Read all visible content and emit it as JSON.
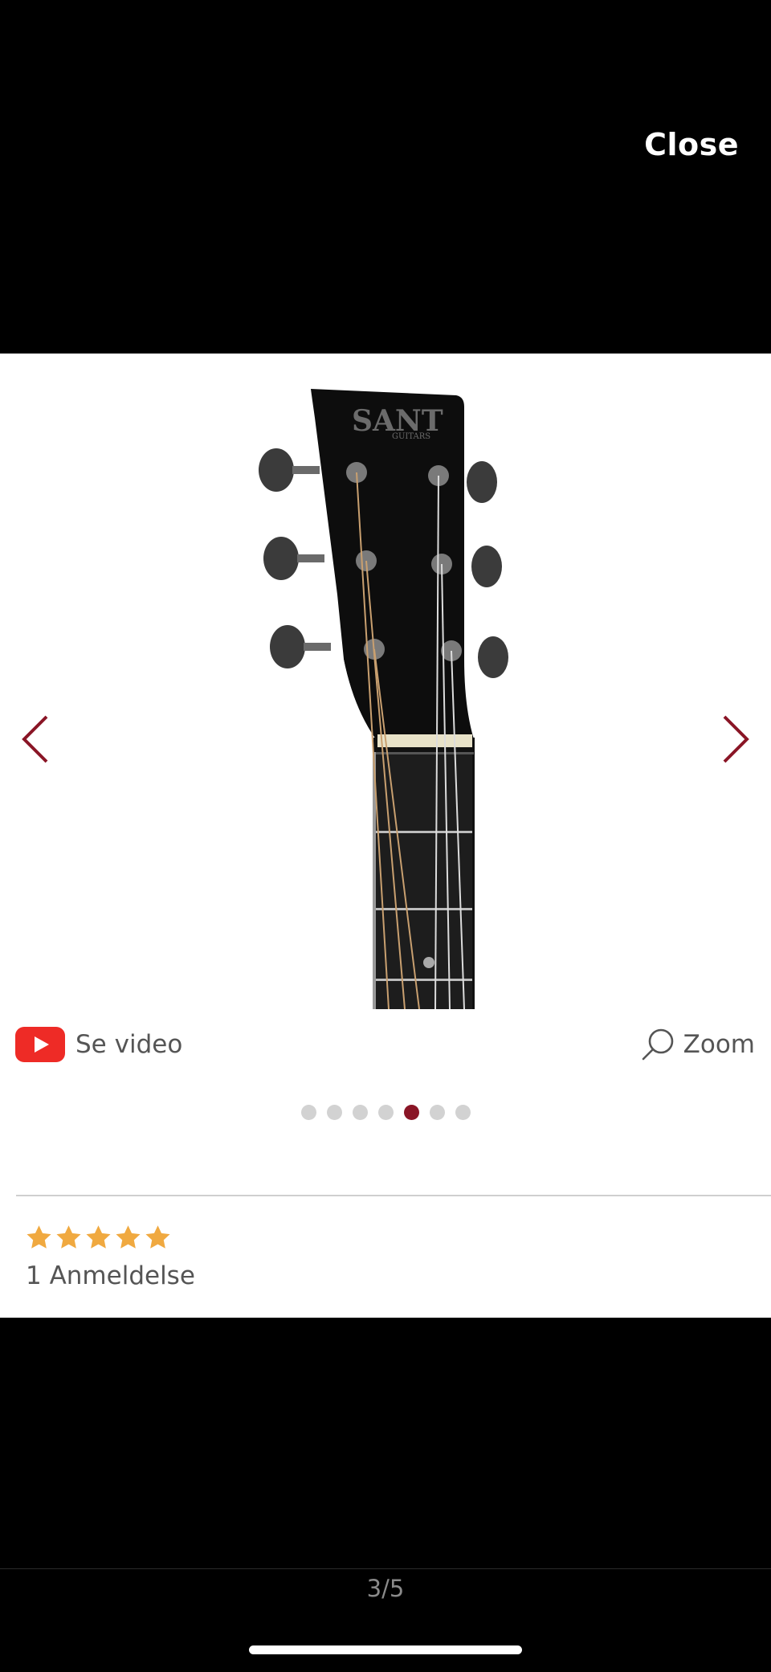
{
  "header": {
    "close_label": "Close"
  },
  "product": {
    "brand_text": "SANT",
    "brand_sub": "GUITARS"
  },
  "gallery": {
    "dots_total": 7,
    "active_dot_index": 4,
    "counter": "3/5"
  },
  "actions": {
    "video_label": "Se video",
    "zoom_label": "Zoom"
  },
  "reviews": {
    "rating": 5,
    "max_rating": 5,
    "count_label": "1 Anmeldelse"
  },
  "colors": {
    "accent": "#8a1526",
    "star": "#f0a940",
    "youtube": "#ee2b26"
  },
  "icons": [
    "chevron-left-icon",
    "chevron-right-icon",
    "youtube-icon",
    "search-icon",
    "star-icon"
  ]
}
